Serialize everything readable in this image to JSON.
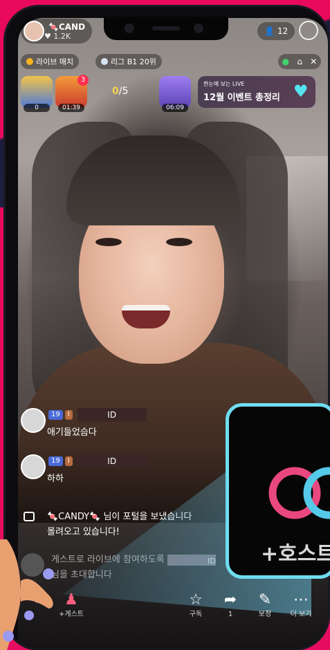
{
  "header": {
    "streamer_name": "CAND",
    "followers": "1.2K",
    "viewer_count": "12"
  },
  "chips": {
    "live_match": "라이브 매치",
    "league": "리그 B1 20위"
  },
  "gifts": {
    "gift1_label": "0",
    "gift2_badge": "3",
    "gift2_timer": "01:39",
    "progress_current": "0",
    "progress_total": "/5",
    "gift4_timer": "06:09"
  },
  "event_banner": {
    "subtitle": "한눈에 보는 LIVE",
    "title": "12월 이벤트 총정리"
  },
  "chat": [
    {
      "badge_level": "19",
      "badge_heart": "I",
      "id": "ID",
      "text": "애기들었슴다"
    },
    {
      "badge_level": "19",
      "badge_heart": "I",
      "id": "ID",
      "text": "하하"
    }
  ],
  "system_message": {
    "line1": "🍬CANDY🍬 님이 포털을 보냈습니다",
    "line2": "몰려오고 있습니다!"
  },
  "guest_invite": {
    "line1": "게스트로 라이브에 참여하도록",
    "id": "ID",
    "line2": "님을 초대합니다"
  },
  "zoom_label": "+호스트",
  "toolbar": {
    "guest_label": "+게스트",
    "subscribe_label": "구독",
    "share_label": "1",
    "boost_label": "보정",
    "more_label": "더 보기"
  },
  "colors": {
    "background_accent": "#ea0a5c",
    "zoom_border": "#6fdcf0",
    "level_badge": "#4a6ad8"
  }
}
